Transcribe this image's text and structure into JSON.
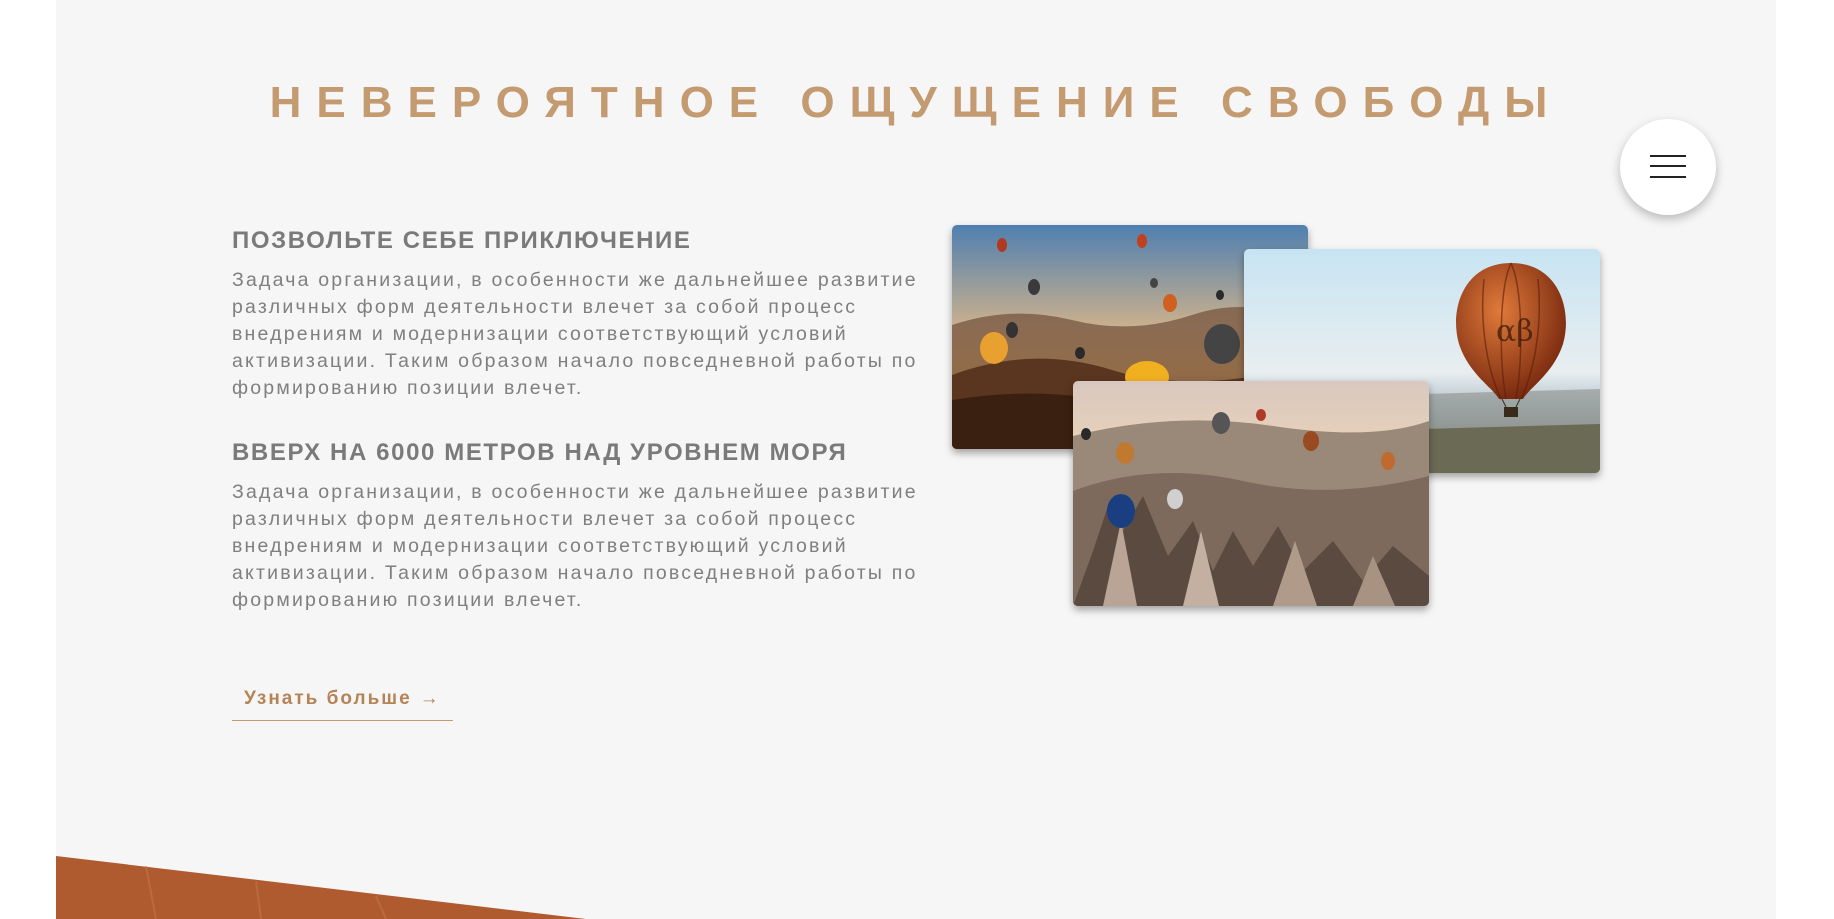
{
  "page": {
    "title": "НЕВЕРОЯТНОЕ ОЩУЩЕНИЕ СВОБОДЫ"
  },
  "menu_button": {
    "icon": "hamburger-menu-icon"
  },
  "sections": [
    {
      "heading": "ПОЗВОЛЬТЕ СЕБЕ ПРИКЛЮЧЕНИЕ",
      "text": "Задача организации, в особенности же дальнейшее развитие различных форм деятельности влечет за собой процесс внедрениям и модернизации соответствующий условий активизации. Таким образом начало повседневной работы по формированию позиции влечет."
    },
    {
      "heading": "ВВЕРХ НА 6000 МЕТРОВ НАД УРОВНЕМ МОРЯ",
      "text": "Задача организации, в особенности же дальнейшее развитие различных форм деятельности влечет за собой процесс внедрениям и модернизации соответствующий условий активизации. Таким образом начало повседневной работы по формированию позиции влечет."
    }
  ],
  "more_link": {
    "label": "Узнать больше",
    "arrow": "→"
  },
  "photos": [
    {
      "alt_icon": "balloons-sunset-photo"
    },
    {
      "alt_icon": "single-balloon-photo"
    },
    {
      "alt_icon": "cappadocia-valley-photo"
    }
  ],
  "colors": {
    "accent": "#c49a70",
    "text": "#7f7f7f",
    "background": "#f6f6f6"
  }
}
